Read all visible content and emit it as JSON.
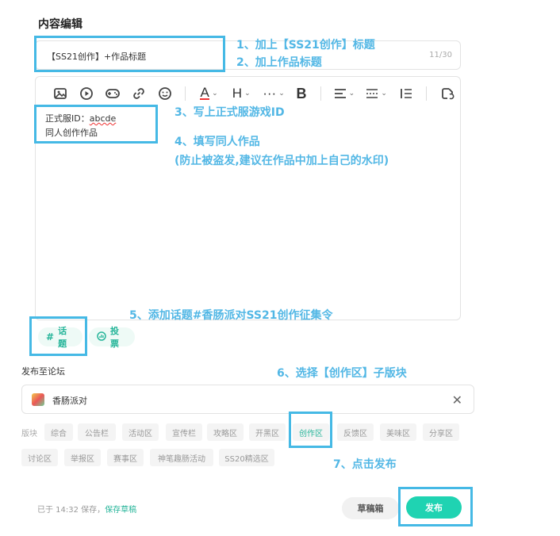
{
  "section_title": "内容编辑",
  "title_field": {
    "value": "【SS21创作】+作品标题",
    "count": "11/30"
  },
  "content": {
    "line1_prefix": "正式服ID：",
    "line1_id": "abcde",
    "line2": "同人创作作品"
  },
  "toolbar": {
    "font_color_letter": "A",
    "heading_letter": "H",
    "more_glyph": "···",
    "bold_letter": "B",
    "icons": [
      "image-icon",
      "video-icon",
      "gamepad-icon",
      "link-icon",
      "emoji-icon",
      "font-color-icon",
      "heading-icon",
      "more-icon",
      "bold-icon",
      "align-icon",
      "divider-icon",
      "indent-icon",
      "redo-icon"
    ]
  },
  "tags": {
    "topic": "话题",
    "vote": "投票"
  },
  "forum": {
    "label": "发布至论坛",
    "selected": "香肠派对",
    "clear": "✕"
  },
  "boards": {
    "label": "版块",
    "row1": [
      "综合",
      "公告栏",
      "活动区",
      "宣传栏",
      "攻略区",
      "开黑区",
      "创作区",
      "反馈区",
      "美味区",
      "分享区"
    ],
    "row2": [
      "讨论区",
      "举报区",
      "赛事区",
      "神笔趣肠活动",
      "SS20精选区"
    ],
    "active": "创作区"
  },
  "footer": {
    "saved_text": "已于 14:32 保存，",
    "save_link": "保存草稿",
    "draft_button": "草稿箱",
    "publish_button": "发布"
  },
  "annotations": {
    "a1": "1、加上【SS21创作】标题",
    "a2": "2、加上作品标题",
    "a3": "3、写上正式服游戏ID",
    "a4": "4、填写同人作品",
    "a4b": "(防止被盗发,建议在作品中加上自己的水印)",
    "a5": "5、添加话题#香肠派对SS21创作征集令",
    "a6": "6、选择【创作区】子版块",
    "a7": "7、点击发布"
  },
  "colors": {
    "accent": "#1fd3b2",
    "annotation": "#52b7e5",
    "highlight_box": "#45b9e5"
  }
}
